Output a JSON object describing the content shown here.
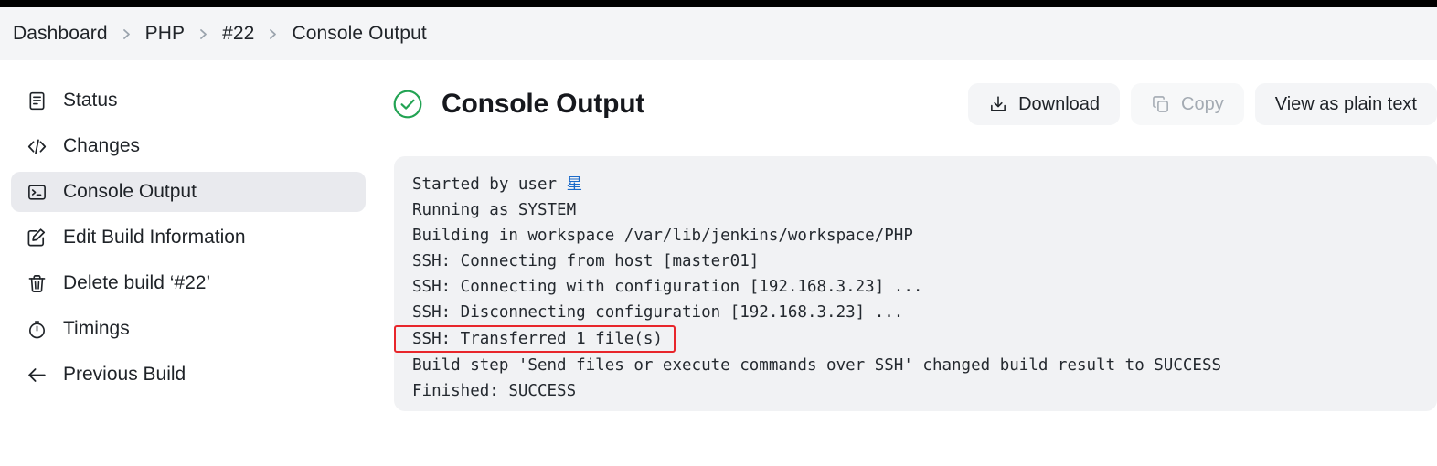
{
  "breadcrumb": {
    "items": [
      {
        "label": "Dashboard"
      },
      {
        "label": "PHP"
      },
      {
        "label": "#22"
      },
      {
        "label": "Console Output"
      }
    ],
    "separator_icon": "chevron-right-icon"
  },
  "sidebar": {
    "items": [
      {
        "label": "Status",
        "icon": "document-icon",
        "active": false
      },
      {
        "label": "Changes",
        "icon": "code-icon",
        "active": false
      },
      {
        "label": "Console Output",
        "icon": "terminal-icon",
        "active": true
      },
      {
        "label": "Edit Build Information",
        "icon": "edit-square-icon",
        "active": false
      },
      {
        "label": "Delete build ‘#22’",
        "icon": "trash-icon",
        "active": false
      },
      {
        "label": "Timings",
        "icon": "stopwatch-icon",
        "active": false
      },
      {
        "label": "Previous Build",
        "icon": "arrow-left-icon",
        "active": false
      }
    ]
  },
  "main": {
    "status_icon": "check-circle-icon",
    "status_color": "#22a353",
    "title": "Console Output",
    "actions": {
      "download": {
        "label": "Download",
        "icon": "download-icon",
        "disabled": false
      },
      "copy": {
        "label": "Copy",
        "icon": "copy-icon",
        "disabled": true
      },
      "plain_text": {
        "label": "View as plain text",
        "disabled": false
      }
    }
  },
  "console": {
    "highlight_color": "#e8262b",
    "link_color": "#1b6ac9",
    "lines": [
      {
        "prefix": "Started by user ",
        "link": "星",
        "highlighted": false
      },
      {
        "text": "Running as SYSTEM",
        "highlighted": false
      },
      {
        "text": "Building in workspace /var/lib/jenkins/workspace/PHP",
        "highlighted": false
      },
      {
        "text": "SSH: Connecting from host [master01]",
        "highlighted": false
      },
      {
        "text": "SSH: Connecting with configuration [192.168.3.23] ...",
        "highlighted": false
      },
      {
        "text": "SSH: Disconnecting configuration [192.168.3.23] ...",
        "highlighted": false
      },
      {
        "text": "SSH: Transferred 1 file(s)",
        "highlighted": true
      },
      {
        "text": "Build step 'Send files or execute commands over SSH' changed build result to SUCCESS",
        "highlighted": false
      },
      {
        "text": "Finished: SUCCESS",
        "highlighted": false
      }
    ]
  }
}
